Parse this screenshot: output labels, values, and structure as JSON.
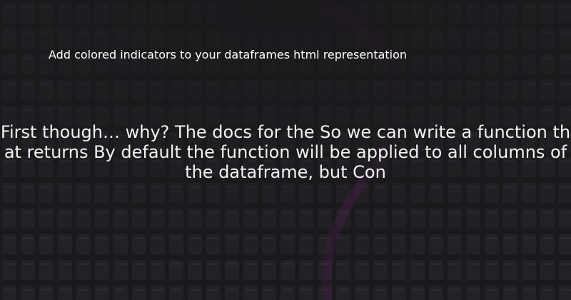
{
  "page": {
    "title": "Add colored indicators to your dataframes html representation",
    "excerpt": "First though… why? The docs for the  So we can write a function that returns  By default the function will be applied to all columns of the dataframe, but Con"
  },
  "colors": {
    "background": "#1b191c",
    "block": "#2a282b",
    "accent_glow": "#5a1a5e",
    "text": "#ffffff"
  }
}
